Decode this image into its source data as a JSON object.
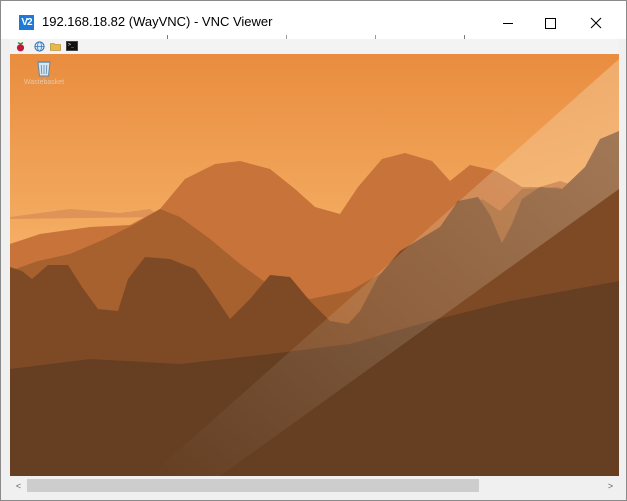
{
  "window": {
    "app_logo": "V2",
    "title": "192.168.18.82 (WayVNC) - VNC Viewer",
    "controls": {
      "minimize": "minimize-icon",
      "maximize": "maximize-icon",
      "close": "close-icon"
    }
  },
  "remote_desktop": {
    "taskbar_icons": [
      "raspberry-pi-menu-icon",
      "web-browser-icon",
      "file-manager-icon",
      "terminal-icon"
    ],
    "terminal_prompt": ">_",
    "desktop_icons": [
      {
        "label": "Wastebasket",
        "icon": "wastebasket-icon"
      }
    ]
  },
  "scrollbar": {
    "orientation": "horizontal",
    "left_arrow": "<",
    "right_arrow": ">"
  },
  "colors": {
    "titlebar": "#ffffff",
    "app_accent": "#1d7ad8",
    "sky_top": "#e88a3c",
    "sky_bottom": "#f6bc76"
  }
}
